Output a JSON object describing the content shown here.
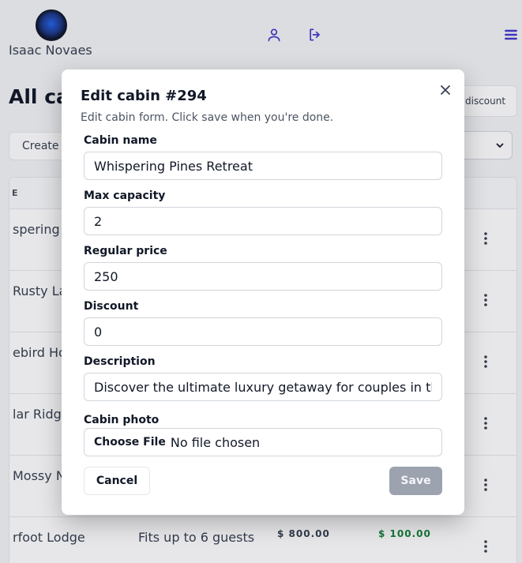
{
  "header": {
    "username": "Isaac Novaes",
    "icons": [
      "user-icon",
      "logout-icon",
      "menu-icon"
    ],
    "accent_color": "#4338ca"
  },
  "page": {
    "title": "All ca",
    "discount_button": "discount",
    "create_button": "Create",
    "table_header": "E",
    "rows": [
      {
        "name": "spering",
        "capacity": "",
        "price": "",
        "discount": ""
      },
      {
        "name": "Rusty La",
        "capacity": "",
        "price": "",
        "discount": ""
      },
      {
        "name": "ebird Hol",
        "capacity": "",
        "price": "",
        "discount": ""
      },
      {
        "name": "lar Ridge",
        "capacity": "",
        "price": "",
        "discount": ""
      },
      {
        "name": "Mossy N",
        "capacity": "",
        "price": "",
        "discount": ""
      },
      {
        "name": "rfoot Lodge",
        "capacity": "Fits up to 6 guests",
        "price": "$ 800.00",
        "discount": "$ 100.00"
      }
    ],
    "discount_color": "#15803d"
  },
  "modal": {
    "title": "Edit cabin #294",
    "description": "Edit cabin form. Click save when you're done.",
    "fields": {
      "name": {
        "label": "Cabin name",
        "value": "Whispering Pines Retreat"
      },
      "capacity": {
        "label": "Max capacity",
        "value": "2"
      },
      "price": {
        "label": "Regular price",
        "value": "250"
      },
      "discount": {
        "label": "Discount",
        "value": "0"
      },
      "description": {
        "label": "Description",
        "value": "Discover the ultimate luxury getaway for couples in th"
      },
      "photo": {
        "label": "Cabin photo",
        "button": "Choose File",
        "status": "No file chosen"
      }
    },
    "cancel_label": "Cancel",
    "save_label": "Save"
  }
}
